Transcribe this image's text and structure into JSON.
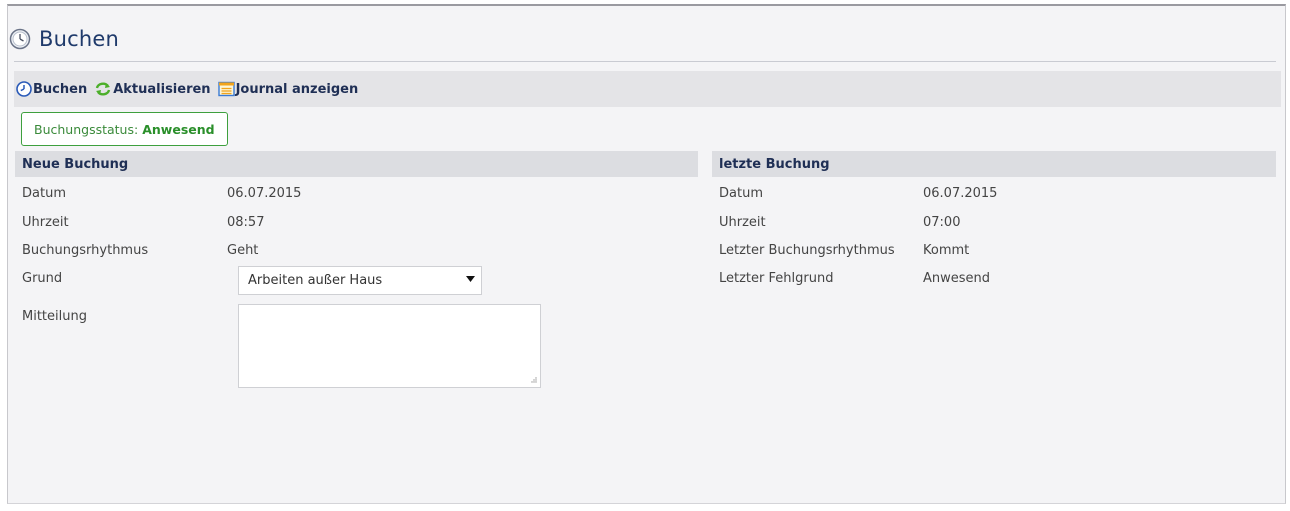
{
  "page": {
    "title": "Buchen"
  },
  "toolbar": {
    "book_label": "Buchen",
    "refresh_label": "Aktualisieren",
    "journal_label": "Journal anzeigen"
  },
  "status": {
    "label": "Buchungsstatus:",
    "value": "Anwesend"
  },
  "new_booking": {
    "header": "Neue Buchung",
    "fields": [
      {
        "label": "Datum",
        "value": "06.07.2015"
      },
      {
        "label": "Uhrzeit",
        "value": "08:57"
      },
      {
        "label": "Buchungsrhythmus",
        "value": "Geht"
      }
    ],
    "reason_label": "Grund",
    "reason_selected": "Arbeiten außer Haus",
    "message_label": "Mitteilung",
    "message_value": ""
  },
  "last_booking": {
    "header": "letzte Buchung",
    "fields": [
      {
        "label": "Datum",
        "value": "06.07.2015"
      },
      {
        "label": "Uhrzeit",
        "value": "07:00"
      },
      {
        "label": "Letzter Buchungsrhythmus",
        "value": "Kommt"
      },
      {
        "label": "Letzter Fehlgrund",
        "value": "Anwesend"
      }
    ]
  },
  "colors": {
    "title": "#1f3a6b",
    "status_border": "#3ea03e",
    "status_value": "#2a8f2a",
    "toolbar_bg": "#e4e4e7",
    "section_bg": "#dcdde1"
  },
  "icons": [
    "clock-icon",
    "booking-clock-icon",
    "refresh-icon",
    "journal-icon",
    "dropdown-arrow-icon",
    "resize-grip-icon"
  ]
}
